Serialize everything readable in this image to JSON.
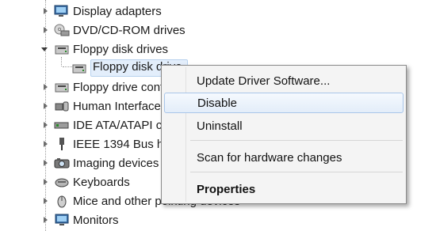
{
  "tree": {
    "items": [
      {
        "label": "Display adapters"
      },
      {
        "label": "DVD/CD-ROM drives"
      },
      {
        "label": "Floppy disk drives"
      },
      {
        "label": "Floppy disk drive"
      },
      {
        "label": "Floppy drive controllers"
      },
      {
        "label": "Human Interface Devices"
      },
      {
        "label": "IDE ATA/ATAPI controllers"
      },
      {
        "label": "IEEE 1394 Bus host controllers"
      },
      {
        "label": "Imaging devices"
      },
      {
        "label": "Keyboards"
      },
      {
        "label": "Mice and other pointing devices"
      },
      {
        "label": "Monitors"
      }
    ]
  },
  "context_menu": {
    "update_driver": "Update Driver Software...",
    "disable": "Disable",
    "uninstall": "Uninstall",
    "scan": "Scan for hardware changes",
    "properties": "Properties"
  },
  "colors": {
    "menu_bg": "#f4f4f4",
    "highlight_border": "#a9c6ea",
    "selection_bg": "#e3eefb"
  }
}
